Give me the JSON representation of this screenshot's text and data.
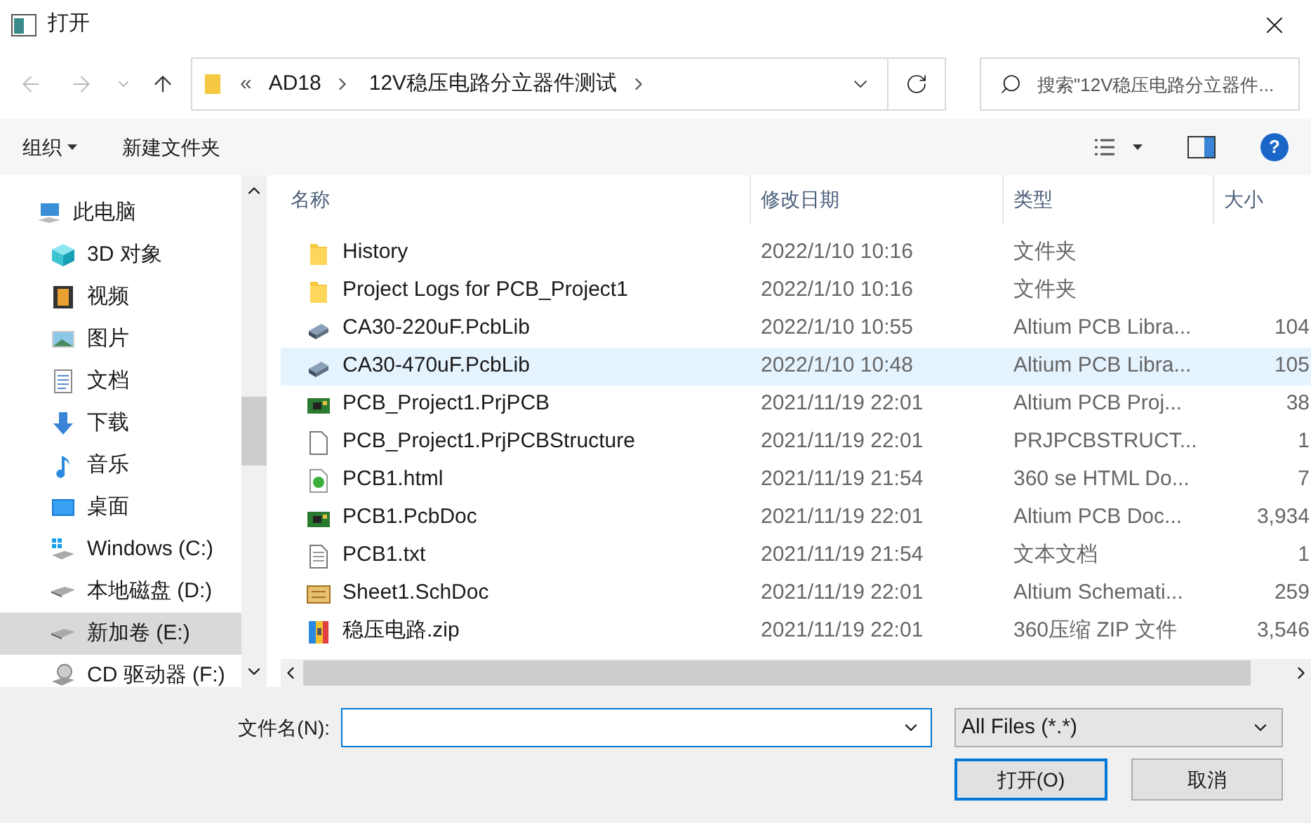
{
  "window": {
    "title": "打开"
  },
  "address": {
    "overflow": "«",
    "crumbs": [
      "AD18",
      "12V稳压电路分立器件测试"
    ]
  },
  "search": {
    "placeholder": "搜索\"12V稳压电路分立器件..."
  },
  "toolbar": {
    "organize": "组织",
    "new_folder": "新建文件夹",
    "help": "?"
  },
  "nav": [
    {
      "label": "此电脑",
      "kind": "pc",
      "selected": false
    },
    {
      "label": "3D 对象",
      "kind": "cube",
      "selected": false
    },
    {
      "label": "视频",
      "kind": "film",
      "selected": false
    },
    {
      "label": "图片",
      "kind": "image",
      "selected": false
    },
    {
      "label": "文档",
      "kind": "doc",
      "selected": false
    },
    {
      "label": "下载",
      "kind": "download",
      "selected": false
    },
    {
      "label": "音乐",
      "kind": "music",
      "selected": false
    },
    {
      "label": "桌面",
      "kind": "desktop",
      "selected": false
    },
    {
      "label": "Windows (C:)",
      "kind": "windrive",
      "selected": false
    },
    {
      "label": "本地磁盘 (D:)",
      "kind": "drive",
      "selected": false
    },
    {
      "label": "新加卷 (E:)",
      "kind": "drive",
      "selected": true
    },
    {
      "label": "CD 驱动器 (F:)",
      "kind": "cd",
      "selected": false
    }
  ],
  "table": {
    "columns": [
      "名称",
      "修改日期",
      "类型",
      "大小"
    ],
    "rows": [
      {
        "name": "History",
        "date": "2022/1/10 10:16",
        "type": "文件夹",
        "kind": "folder",
        "selected": false
      },
      {
        "name": "Project Logs for PCB_Project1",
        "date": "2022/1/10 10:16",
        "type": "文件夹",
        "kind": "folder",
        "selected": false
      },
      {
        "name": "CA30-220uF.PcbLib",
        "date": "2022/1/10 10:55",
        "type": "Altium PCB Libra...",
        "size": "104",
        "kind": "chip",
        "selected": false
      },
      {
        "name": "CA30-470uF.PcbLib",
        "date": "2022/1/10 10:48",
        "type": "Altium PCB Libra...",
        "size": "105",
        "kind": "chip",
        "selected": true
      },
      {
        "name": "PCB_Project1.PrjPCB",
        "date": "2021/11/19 22:01",
        "type": "Altium PCB Proj...",
        "size": "38",
        "kind": "board",
        "selected": false
      },
      {
        "name": "PCB_Project1.PrjPCBStructure",
        "date": "2021/11/19 22:01",
        "type": "PRJPCBSTRUCT...",
        "size": "1",
        "kind": "file",
        "selected": false
      },
      {
        "name": "PCB1.html",
        "date": "2021/11/19 21:54",
        "type": "360 se HTML Do...",
        "size": "7",
        "kind": "html",
        "selected": false
      },
      {
        "name": "PCB1.PcbDoc",
        "date": "2021/11/19 22:01",
        "type": "Altium PCB Doc...",
        "size": "3,934",
        "kind": "board",
        "selected": false
      },
      {
        "name": "PCB1.txt",
        "date": "2021/11/19 21:54",
        "type": "文本文档",
        "size": "1",
        "kind": "text",
        "selected": false
      },
      {
        "name": "Sheet1.SchDoc",
        "date": "2021/11/19 22:01",
        "type": "Altium Schemati...",
        "size": "259",
        "kind": "sheet",
        "selected": false
      },
      {
        "name": "稳压电路.zip",
        "date": "2021/11/19 22:01",
        "type": "360压缩 ZIP 文件",
        "size": "3,546",
        "kind": "zip",
        "selected": false
      }
    ]
  },
  "filename": {
    "label": "文件名(N):"
  },
  "filter": {
    "value": "All Files (*.*)"
  },
  "buttons": {
    "open": "打开(O)",
    "cancel": "取消"
  }
}
